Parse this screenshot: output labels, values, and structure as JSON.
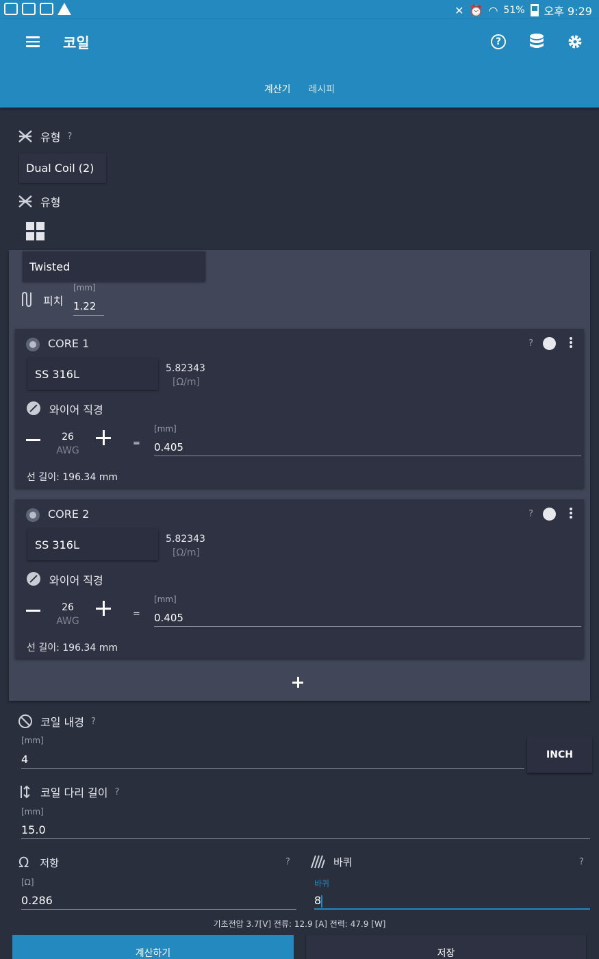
{
  "status_bar": {
    "battery": "51%",
    "time": "오후 9:29"
  },
  "app": {
    "title": "코일",
    "tabs": [
      "계산기",
      "레시피"
    ],
    "active_tab": "계산기",
    "accent_color": "#2389be"
  },
  "coil_type": {
    "label": "유형",
    "help": "?",
    "value": "Dual Coil (2)"
  },
  "wire_type": {
    "label": "유형",
    "value": "Twisted",
    "pitch_label": "피치",
    "pitch_unit": "[mm]",
    "pitch_value": "1.22"
  },
  "cores": [
    {
      "title": "CORE 1",
      "help": "?",
      "material": "SS 316L",
      "resistivity": "5.82343",
      "resistivity_unit": "[Ω/m]",
      "diameter_label": "와이어 직경",
      "awg": "26",
      "awg_unit": "AWG",
      "equals": "=",
      "mm_unit": "[mm]",
      "mm_value": "0.405",
      "length_label": "선 길이: 196.34 mm"
    },
    {
      "title": "CORE 2",
      "help": "?",
      "material": "SS 316L",
      "resistivity": "5.82343",
      "resistivity_unit": "[Ω/m]",
      "diameter_label": "와이어 직경",
      "awg": "26",
      "awg_unit": "AWG",
      "equals": "=",
      "mm_unit": "[mm]",
      "mm_value": "0.405",
      "length_label": "선 길이: 196.34 mm"
    }
  ],
  "inner_diameter": {
    "label": "코일 내경",
    "help": "?",
    "unit": "[mm]",
    "value": "4",
    "unit_toggle": "INCH"
  },
  "leg_length": {
    "label": "코일 다리 길이",
    "help": "?",
    "unit": "[mm]",
    "value": "15.0"
  },
  "resistance": {
    "label": "저항",
    "help": "?",
    "unit": "[Ω]",
    "value": "0.286"
  },
  "wraps": {
    "label": "바퀴",
    "help": "?",
    "floating_label": "바퀴",
    "value": "8"
  },
  "info_line": "기초전압 3.7[V]  전류: 12.9 [A]  전력: 47.9 [W]",
  "buttons": {
    "calculate": "계산하기",
    "save": "저장"
  }
}
